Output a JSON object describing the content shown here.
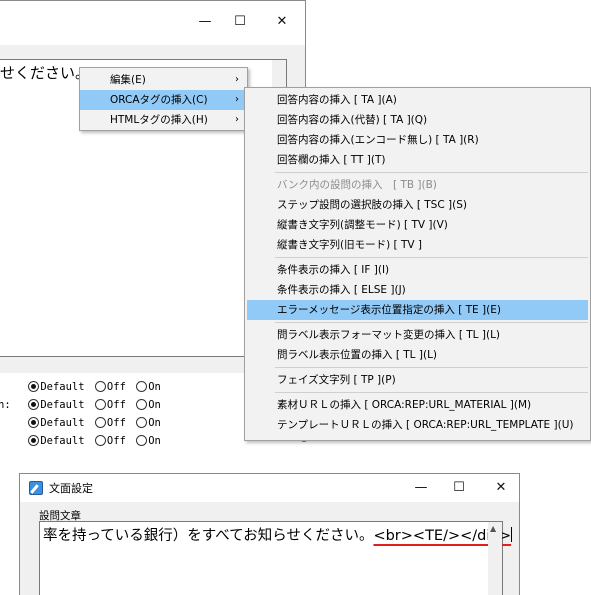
{
  "top_window": {
    "editor_text_visible": "せください。<",
    "lower_options": [
      {
        "label": "",
        "options": [
          "Default",
          "Off",
          "On"
        ],
        "selected": 0
      },
      {
        "label": "n:",
        "options": [
          "Default",
          "Off",
          "On"
        ],
        "selected": 0
      },
      {
        "label": "",
        "options": [
          "Default",
          "Off",
          "On"
        ],
        "selected": 0
      },
      {
        "label": "",
        "options": [
          "Default",
          "Off",
          "On"
        ],
        "selected": 0
      }
    ]
  },
  "caption_buttons": {
    "minimize": "—",
    "maximize": "☐",
    "close": "✕"
  },
  "context_menu": {
    "items": [
      {
        "label": "編集(E)",
        "arrow": "›"
      },
      {
        "label": "ORCAタグの挿入(C)",
        "arrow": "›"
      },
      {
        "label": "HTMLタグの挿入(H)",
        "arrow": "›"
      }
    ],
    "highlighted_index": 1
  },
  "submenu": {
    "groups": [
      [
        {
          "label": "回答内容の挿入 [ TA ](A)"
        },
        {
          "label": "回答内容の挿入(代替) [ TA ](Q)"
        },
        {
          "label": "回答内容の挿入(エンコード無し) [ TA ](R)"
        },
        {
          "label": "回答欄の挿入 [ TT ](T)"
        }
      ],
      [
        {
          "label": "バンク内の設問の挿入　[ TB ](B)",
          "disabled": true
        },
        {
          "label": "ステップ設問の選択肢の挿入 [ TSC ](S)"
        },
        {
          "label": "縦書き文字列(調整モード) [ TV ](V)"
        },
        {
          "label": "縦書き文字列(旧モード) [ TV ]"
        }
      ],
      [
        {
          "label": "条件表示の挿入 [ IF ](I)"
        },
        {
          "label": "条件表示の挿入 [ ELSE ](J)"
        },
        {
          "label": "エラーメッセージ表示位置指定の挿入 [ TE ](E)",
          "highlighted": true
        }
      ],
      [
        {
          "label": "問ラベル表示フォーマット変更の挿入 [ TL ](L)"
        },
        {
          "label": "問ラベル表示位置の挿入 [ TL ](L)"
        }
      ],
      [
        {
          "label": "フェイズ文字列 [ TP ](P)"
        }
      ],
      [
        {
          "label": "素材ＵＲＬの挿入 [ ORCA:REP:URL_MATERIAL ](M)"
        },
        {
          "label": "テンプレートＵＲＬの挿入 [ ORCA:REP:URL_TEMPLATE ](U)"
        }
      ]
    ]
  },
  "bottom_window": {
    "title": "文面設定",
    "field_label": "設問文章",
    "editor_text_prefix": "率を持っている銀行）をすべてお知らせください。",
    "editor_text_tag": "<br><TE/></div>"
  },
  "colors": {
    "highlight": "#91c9f7",
    "underline": "#e02020"
  }
}
